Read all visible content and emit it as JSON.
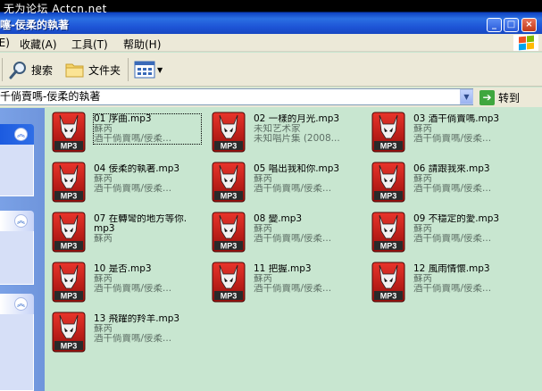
{
  "window": {
    "watermark": "无为论坛 Actcn.net",
    "title": "噻-佞柔的執著",
    "buttons": [
      "_",
      "□",
      "×"
    ]
  },
  "menu": {
    "items": [
      {
        "label": "(E)"
      },
      {
        "label": "收藏(A)"
      },
      {
        "label": "工具(T)"
      },
      {
        "label": "帮助(H)"
      }
    ]
  },
  "toolbar": {
    "search_label": "搜索",
    "folders_label": "文件夹"
  },
  "address": {
    "value": "千倘賣嗎-佞柔的執著",
    "go_label": "转到"
  },
  "files": [
    {
      "name": "01 序曲.mp3",
      "artist": "蘇芮",
      "album": "酒干倘賣嗎/佞柔...",
      "selected": true
    },
    {
      "name": "02 一樣的月光.mp3",
      "artist": "未知艺术家",
      "album": "未知唱片集 (2008..."
    },
    {
      "name": "03 酒干倘賣嗎.mp3",
      "artist": "蘇芮",
      "album": "酒干倘賣嗎/佞柔..."
    },
    {
      "name": "04 佞柔的執著.mp3",
      "artist": "蘇芮",
      "album": "酒干倘賣嗎/佞柔..."
    },
    {
      "name": "05 唱出我和你.mp3",
      "artist": "蘇芮",
      "album": "酒干倘賣嗎/佞柔..."
    },
    {
      "name": "06 請跟我來.mp3",
      "artist": "蘇芮",
      "album": "酒干倘賣嗎/佞柔..."
    },
    {
      "name": "07 在轉彎的地方等你.mp3",
      "artist": "蘇芮",
      "album": ""
    },
    {
      "name": "08 變.mp3",
      "artist": "蘇芮",
      "album": "酒干倘賣嗎/佞柔..."
    },
    {
      "name": "09 不穩定的愛.mp3",
      "artist": "蘇芮",
      "album": "酒干倘賣嗎/佞柔..."
    },
    {
      "name": "10 是否.mp3",
      "artist": "蘇芮",
      "album": "酒干倘賣嗎/佞柔..."
    },
    {
      "name": "11 把握.mp3",
      "artist": "蘇芮",
      "album": "酒干倘賣嗎/佞柔..."
    },
    {
      "name": "12 風雨情懷.mp3",
      "artist": "蘇芮",
      "album": "酒干倘賣嗎/佞柔..."
    },
    {
      "name": "13 飛躍的羚羊.mp3",
      "artist": "蘇芮",
      "album": "酒干倘賣嗎/佞柔..."
    }
  ],
  "icon_label": "MP3",
  "colors": {
    "content_bg": "#c8e6d0",
    "titlebar": "#2b6fe3",
    "taskpane": "#7aa1e6"
  }
}
